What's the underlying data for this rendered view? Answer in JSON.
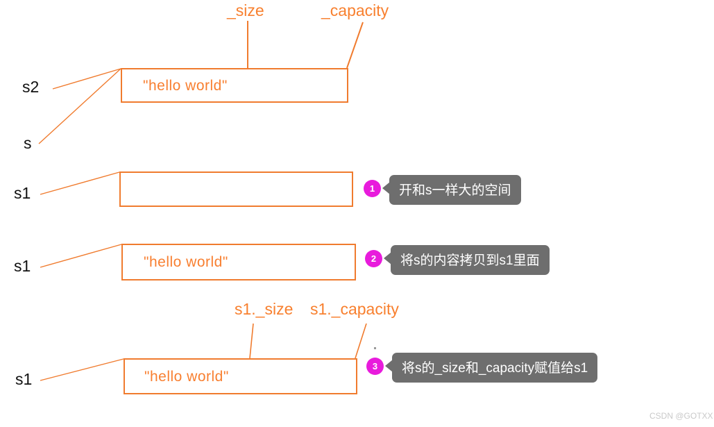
{
  "diagram": {
    "title_fields": {
      "size_label": "_size",
      "capacity_label": "_capacity",
      "s1_size_label": "s1._size",
      "s1_capacity_label": "s1._capacity"
    },
    "colors": {
      "orange": "#F07B2E",
      "orange_text": "#F8802F",
      "badge_magenta": "#E81BDC",
      "tooltip_gray": "#6E6E6E",
      "label_black": "#111111",
      "watermark_gray": "#c9c9c9"
    },
    "rows": [
      {
        "id": "row-s2-s",
        "pointers": [
          "s2",
          "s"
        ],
        "content": "\"hello  world\""
      },
      {
        "id": "row-s1-empty",
        "pointers": [
          "s1"
        ],
        "content": "",
        "step": {
          "number": "1",
          "text": "开和s一样大的空间"
        }
      },
      {
        "id": "row-s1-copied",
        "pointers": [
          "s1"
        ],
        "content": "\"hello  world\"",
        "step": {
          "number": "2",
          "text": "将s的内容拷贝到s1里面"
        }
      },
      {
        "id": "row-s1-fields",
        "pointers": [
          "s1"
        ],
        "content": "\"hello  world\"",
        "step": {
          "number": "3",
          "text": "将s的_size和_capacity赋值给s1"
        }
      }
    ]
  },
  "watermark": "CSDN @GOTXX"
}
